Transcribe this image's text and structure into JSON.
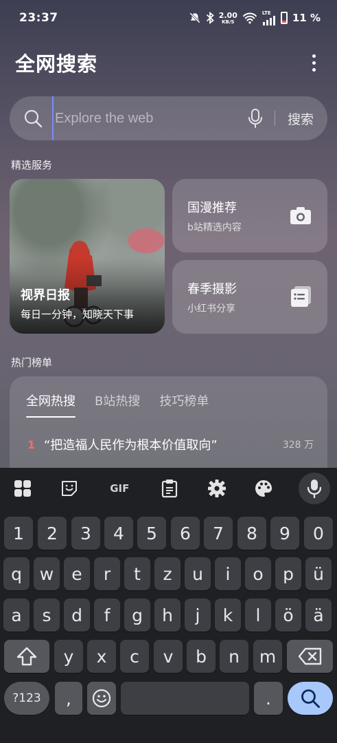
{
  "status_bar": {
    "time": "23:37",
    "net_speed_value": "2.00",
    "net_speed_unit": "KB/S",
    "lte_label": "LTE",
    "battery_percent": "11 %"
  },
  "header": {
    "title": "全网搜索"
  },
  "search": {
    "placeholder": "Explore the web",
    "button_label": "搜索"
  },
  "featured_section": {
    "label": "精选服务",
    "main_card": {
      "title": "视界日报",
      "subtitle": "每日一分钟，知晓天下事"
    },
    "cards": [
      {
        "title": "国漫推荐",
        "subtitle": "b站精选内容",
        "icon": "camera-icon"
      },
      {
        "title": "春季摄影",
        "subtitle": "小红书分享",
        "icon": "notes-icon"
      }
    ]
  },
  "trending_section": {
    "label": "热门榜单",
    "tabs": [
      "全网热搜",
      "B站热搜",
      "技巧榜单"
    ],
    "active_tab": 0,
    "items": [
      {
        "rank": "1",
        "text": "“把造福人民作为根本价值取向”",
        "count": "328 万"
      }
    ]
  },
  "keyboard": {
    "toolbar": [
      "apps-icon",
      "sticker-icon",
      "GIF",
      "clipboard-icon",
      "settings-icon",
      "palette-icon",
      "mic-icon"
    ],
    "gif_label": "GIF",
    "rows": [
      [
        "1",
        "2",
        "3",
        "4",
        "5",
        "6",
        "7",
        "8",
        "9",
        "0"
      ],
      [
        "q",
        "w",
        "e",
        "r",
        "t",
        "z",
        "u",
        "i",
        "o",
        "p",
        "ü"
      ],
      [
        "a",
        "s",
        "d",
        "f",
        "g",
        "h",
        "j",
        "k",
        "l",
        "ö",
        "ä"
      ],
      [
        "y",
        "x",
        "c",
        "v",
        "b",
        "n",
        "m"
      ]
    ],
    "symbols_label": "?123",
    "comma_label": ",",
    "period_label": "."
  },
  "colors": {
    "accent": "#a8c7fa",
    "rank_highlight": "#ff6b5e",
    "keyboard_bg": "#1f2023"
  }
}
